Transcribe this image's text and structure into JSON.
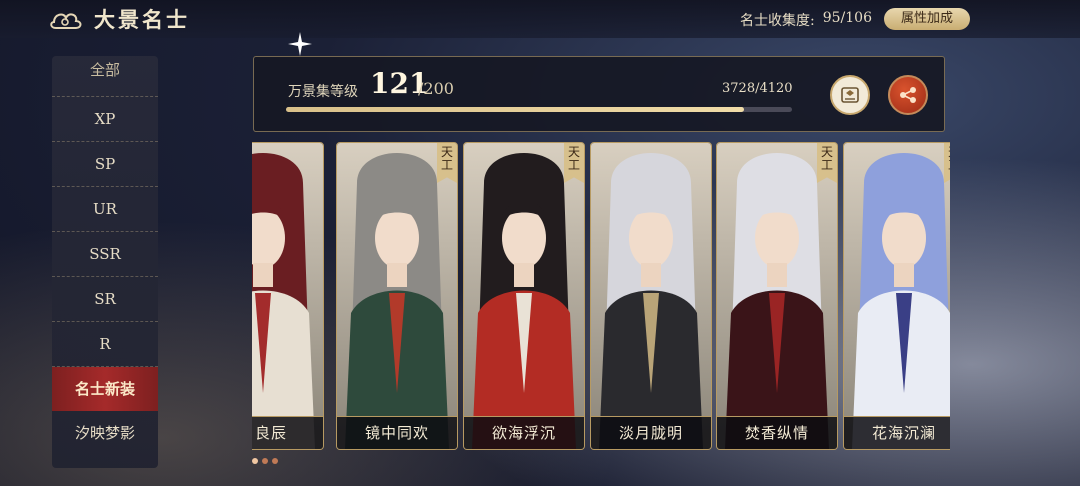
{
  "header": {
    "title": "大景名士",
    "collection_label": "名士收集度:",
    "collection_value": "95/106",
    "attr_button": "属性加成"
  },
  "sidebar": {
    "items": [
      {
        "label": "全部",
        "active": false
      },
      {
        "label": "XP",
        "active": false
      },
      {
        "label": "SP",
        "active": false
      },
      {
        "label": "UR",
        "active": false
      },
      {
        "label": "SSR",
        "active": false
      },
      {
        "label": "SR",
        "active": false
      },
      {
        "label": "R",
        "active": false
      },
      {
        "label": "名士新装",
        "active": true
      },
      {
        "label": "汐映梦影",
        "active": false
      }
    ]
  },
  "progress": {
    "label": "万景集等级",
    "level": "121",
    "level_max": "/200",
    "exp_text": "3728/4120",
    "fill_fraction": 0.905
  },
  "cards": [
    {
      "name": "月良辰",
      "tag": "",
      "hair": "#6a1e22",
      "robe": "#e7dfd2",
      "accent": "#a32c2c"
    },
    {
      "name": "镜中同欢",
      "tag": "天工",
      "hair": "#8c8a86",
      "robe": "#2e4a3c",
      "accent": "#b23a2a"
    },
    {
      "name": "欲海浮沉",
      "tag": "天工",
      "hair": "#221c1e",
      "robe": "#b32c24",
      "accent": "#e9e2d6"
    },
    {
      "name": "淡月胧明",
      "tag": "",
      "hair": "#d6d6dc",
      "robe": "#2a2a2e",
      "accent": "#b9a478"
    },
    {
      "name": "焚香纵情",
      "tag": "天工",
      "hair": "#dedee4",
      "robe": "#3a1418",
      "accent": "#9a2424"
    },
    {
      "name": "花海沉澜",
      "tag": "天工",
      "hair": "#8ea0dc",
      "robe": "#e9ecf4",
      "accent": "#3a3f86"
    }
  ],
  "colors": {
    "accent_red": "#a52a2a",
    "gold": "#c9ad72"
  }
}
